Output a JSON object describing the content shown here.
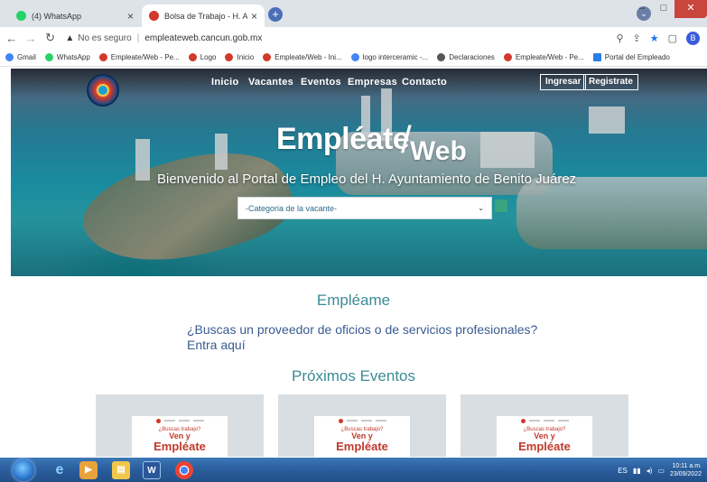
{
  "browser": {
    "tabs": [
      {
        "title": "(4) WhatsApp",
        "icon": "whatsapp-icon",
        "active": false
      },
      {
        "title": "Bolsa de Trabajo - H. Ayuntamien",
        "icon": "site-icon",
        "active": true
      }
    ],
    "new_tab_label": "+",
    "profile_initial": "",
    "address": {
      "warning": "No es seguro",
      "url": "empleateweb.cancun.gob.mx"
    },
    "account_initial": "B",
    "bookmarks": [
      {
        "label": "Gmail",
        "icon": "google-icon"
      },
      {
        "label": "WhatsApp",
        "icon": "whatsapp-icon"
      },
      {
        "label": "Empleate/Web - Pe...",
        "icon": "site-icon"
      },
      {
        "label": "Logo",
        "icon": "site-icon"
      },
      {
        "label": "Inicio",
        "icon": "site-icon"
      },
      {
        "label": "Empleate/Web - Ini...",
        "icon": "site-icon"
      },
      {
        "label": "logo interceramic -...",
        "icon": "google-icon"
      },
      {
        "label": "Declaraciones",
        "icon": "globe-icon"
      },
      {
        "label": "Empleate/Web - Pe...",
        "icon": "site-icon"
      },
      {
        "label": "Portal del Empleado",
        "icon": "pin-icon"
      }
    ]
  },
  "site": {
    "nav": {
      "links": [
        "Inicio",
        "Vacantes",
        "Eventos",
        "Empresas",
        "Contacto"
      ],
      "login": "Ingresar",
      "register": "Registrate"
    },
    "brand": {
      "part1": "Empléate",
      "part2": "Web"
    },
    "welcome": "Bienvenido al Portal de Empleo del H. Ayuntamiento de Benito Juárez",
    "category_select": {
      "selected": "-Categoria de la vacante-"
    },
    "empleame_heading": "Empléame",
    "providers_text": "¿Buscas un proveedor de oficios o de servicios profesionales? Entra aquí",
    "events_heading": "Próximos Eventos",
    "event_cards": [
      {
        "question": "¿Buscas trabajo?",
        "line1": "Ven y",
        "line2": "Empléate"
      },
      {
        "question": "¿Buscas trabajo?",
        "line1": "Ven y",
        "line2": "Empléate"
      },
      {
        "question": "¿Buscas trabajo?",
        "line1": "Ven y",
        "line2": "Empléate"
      }
    ]
  },
  "taskbar": {
    "language": "ES",
    "time": "10:11 a.m.",
    "date": "23/09/2022"
  },
  "colors": {
    "accent_teal": "#3b8b95",
    "link_blue": "#3a5b91",
    "taskbar_blue": "#2b5f9e"
  }
}
